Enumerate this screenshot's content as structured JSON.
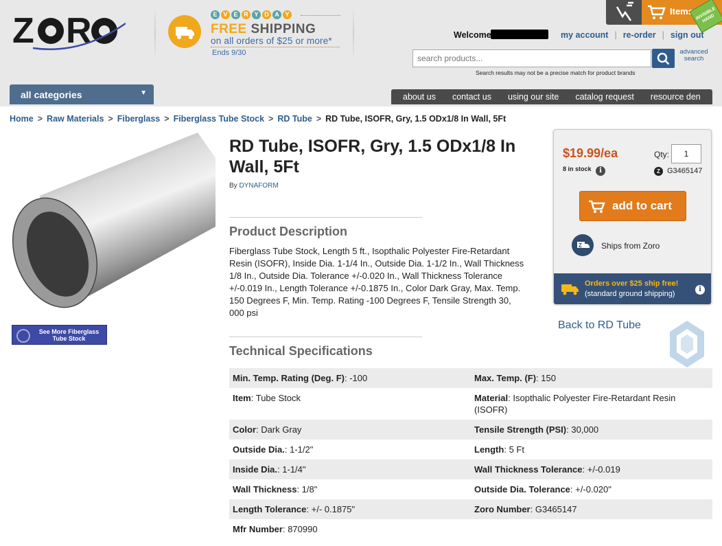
{
  "brand": {
    "logo_text": "ZORO"
  },
  "promo_header": {
    "everyday": [
      "E",
      "V",
      "E",
      "R",
      "Y",
      "D",
      "A",
      "Y"
    ],
    "free": "FREE",
    "shipping": "SHIPPING",
    "subline": "on all orders of $25 or more*",
    "ends": "Ends 9/30"
  },
  "cart": {
    "items_label": "Items:",
    "badge": "INVISIBLE HAND"
  },
  "user": {
    "welcome": "Welcome,"
  },
  "top_links": [
    "my account",
    "re-order",
    "sign out"
  ],
  "search": {
    "placeholder": "search products...",
    "advanced": "advanced search",
    "disclaimer": "Search results may not be a precise match for product brands"
  },
  "categories_button": "all categories",
  "nav": [
    "about us",
    "contact us",
    "using our site",
    "catalog request",
    "resource den"
  ],
  "breadcrumb": [
    "Home",
    "Raw Materials",
    "Fiberglass",
    "Fiberglass Tube Stock",
    "RD Tube"
  ],
  "breadcrumb_current": "RD Tube, ISOFR, Gry, 1.5 ODx1/8 In Wall, 5Ft",
  "see_more": "See More Fiberglass Tube Stock",
  "product": {
    "title": "RD Tube, ISOFR, Gry, 1.5 ODx1/8 In Wall, 5Ft",
    "by_label": "By",
    "brand": "DYNAFORM",
    "desc_heading": "Product Description",
    "description": "Fiberglass Tube Stock, Length 5 ft., Isopthalic Polyester Fire-Retardant Resin (ISOFR), Inside Dia. 1-1/4 In., Outside Dia. 1-1/2 In., Wall Thickness 1/8 In., Outside Dia. Tolerance +/-0.020 In., Wall Thickness Tolerance +/-0.019 In., Length Tolerance +/-0.1875 In., Color Dark Gray, Max. Temp. 150 Degrees F, Min. Temp. Rating -100 Degrees F, Tensile Strength 30, 000 psi",
    "spec_heading": "Technical Specifications"
  },
  "buybox": {
    "price": "$19.99/ea",
    "stock": "8 in stock",
    "qty_label": "Qty:",
    "qty_value": "1",
    "zoro_no": "G3465147",
    "add_to_cart": "add to cart",
    "ships_from": "Ships from Zoro",
    "promo_line1": "Orders over $25 ship free!",
    "promo_line2": "(standard ground shipping)"
  },
  "back_link": "Back to RD Tube",
  "specs": [
    [
      {
        "k": "Min. Temp. Rating (Deg. F)",
        "v": "-100"
      },
      {
        "k": "Max. Temp. (F)",
        "v": "150"
      }
    ],
    [
      {
        "k": "Item",
        "v": "Tube Stock"
      },
      {
        "k": "Material",
        "v": "Isopthalic Polyester Fire-Retardant Resin (ISOFR)"
      }
    ],
    [
      {
        "k": "Color",
        "v": "Dark Gray"
      },
      {
        "k": "Tensile Strength (PSI)",
        "v": "30,000"
      }
    ],
    [
      {
        "k": "Outside Dia.",
        "v": "1-1/2\""
      },
      {
        "k": "Length",
        "v": "5 Ft"
      }
    ],
    [
      {
        "k": "Inside Dia.",
        "v": "1-1/4\""
      },
      {
        "k": "Wall Thickness Tolerance",
        "v": "+/-0.019"
      }
    ],
    [
      {
        "k": "Wall Thickness",
        "v": "1/8\""
      },
      {
        "k": "Outside Dia. Tolerance",
        "v": "+/-0.020\""
      }
    ],
    [
      {
        "k": "Length Tolerance",
        "v": "+/- 0.1875\""
      },
      {
        "k": "Zoro Number",
        "v": "G3465147"
      }
    ],
    [
      {
        "k": "Mfr Number",
        "v": "870990"
      },
      {
        "k": "",
        "v": ""
      }
    ]
  ],
  "colors": {
    "link": "#2f5c8c",
    "price": "#c8531b",
    "cart_orange": "#e17b1b",
    "nav": "#4a4a4a",
    "promo_blue": "#355178"
  }
}
